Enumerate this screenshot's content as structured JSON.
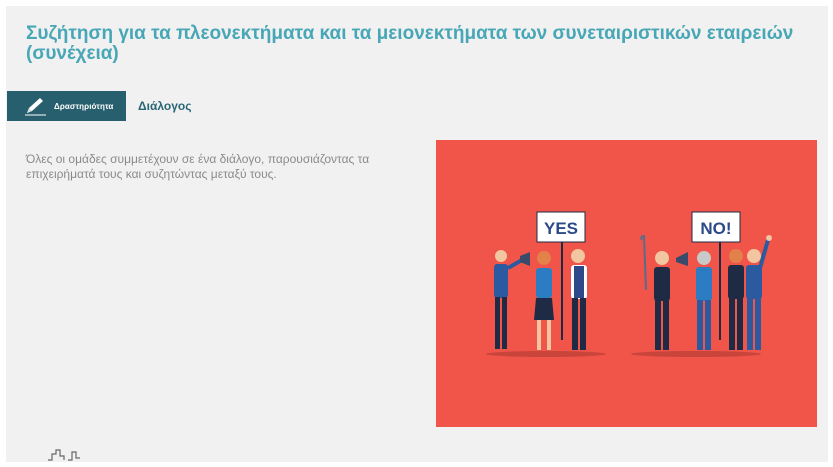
{
  "page": {
    "title": "Συζήτηση για τα πλεονεκτήματα και τα μειονεκτήματα των συνεταιριστικών εταιρειών (συνέχεια)"
  },
  "activity": {
    "tag_label": "Δραστηριότητα",
    "tag_icon": "pencil-icon",
    "name": "Διάλογος"
  },
  "content": {
    "description": "Όλες οι ομάδες συμμετέχουν σε ένα διάλογο, παρουσιάζοντας τα επιχειρήματά τους και συζητώντας μεταξύ τους."
  },
  "illustration": {
    "sign_yes": "YES",
    "sign_no": "NO!"
  },
  "colors": {
    "title": "#47a7b6",
    "tag_background": "#285f6e",
    "illustration_background": "#f15449",
    "panel_background": "#f1f1f1"
  }
}
